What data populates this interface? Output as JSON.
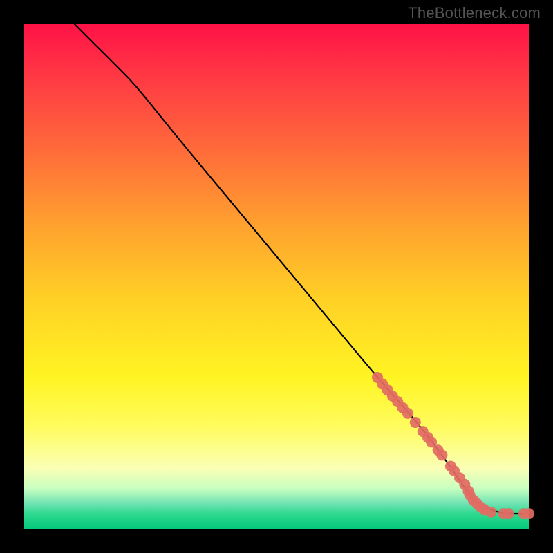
{
  "watermark": "TheBottleneck.com",
  "chart_data": {
    "type": "line",
    "title": "",
    "xlabel": "",
    "ylabel": "",
    "xlim": [
      0,
      100
    ],
    "ylim": [
      0,
      100
    ],
    "curve": {
      "name": "bottleneck-curve",
      "x": [
        10,
        12,
        15,
        18,
        22,
        30,
        40,
        50,
        60,
        70,
        78,
        84,
        88,
        90,
        93,
        96,
        100
      ],
      "y": [
        100,
        98,
        95,
        92,
        88,
        78,
        66,
        54,
        42,
        30,
        21,
        13,
        7,
        5,
        3.5,
        3,
        3
      ]
    },
    "markers": {
      "name": "highlighted-points",
      "color": "#e26b63",
      "radius_px": 8,
      "points": [
        {
          "x": 70,
          "y": 30
        },
        {
          "x": 71,
          "y": 28.7
        },
        {
          "x": 72,
          "y": 27.5
        },
        {
          "x": 73,
          "y": 26.3
        },
        {
          "x": 74,
          "y": 25.2
        },
        {
          "x": 75,
          "y": 24.0
        },
        {
          "x": 76,
          "y": 22.9
        },
        {
          "x": 77.5,
          "y": 21.1
        },
        {
          "x": 79,
          "y": 19.3
        },
        {
          "x": 80,
          "y": 18.1
        },
        {
          "x": 80.7,
          "y": 17.2
        },
        {
          "x": 82,
          "y": 15.6
        },
        {
          "x": 82.8,
          "y": 14.6
        },
        {
          "x": 84.5,
          "y": 12.4
        },
        {
          "x": 85.2,
          "y": 11.5
        },
        {
          "x": 86.3,
          "y": 10.1
        },
        {
          "x": 87.3,
          "y": 8.8
        },
        {
          "x": 88,
          "y": 7.5
        },
        {
          "x": 88.3,
          "y": 6.7
        },
        {
          "x": 89,
          "y": 5.7
        },
        {
          "x": 89.7,
          "y": 5.0
        },
        {
          "x": 90.5,
          "y": 4.3
        },
        {
          "x": 91.2,
          "y": 3.8
        },
        {
          "x": 92.5,
          "y": 3.3
        },
        {
          "x": 95,
          "y": 3.0
        },
        {
          "x": 96,
          "y": 3.0
        },
        {
          "x": 99,
          "y": 3.0
        },
        {
          "x": 100,
          "y": 3.0
        }
      ]
    },
    "gradient_stops": [
      {
        "pos": 0.0,
        "color": "#ff1246"
      },
      {
        "pos": 0.25,
        "color": "#ff6b3a"
      },
      {
        "pos": 0.55,
        "color": "#ffd225"
      },
      {
        "pos": 0.8,
        "color": "#fffc60"
      },
      {
        "pos": 0.95,
        "color": "#6fe3b3"
      },
      {
        "pos": 1.0,
        "color": "#04c97b"
      }
    ]
  }
}
